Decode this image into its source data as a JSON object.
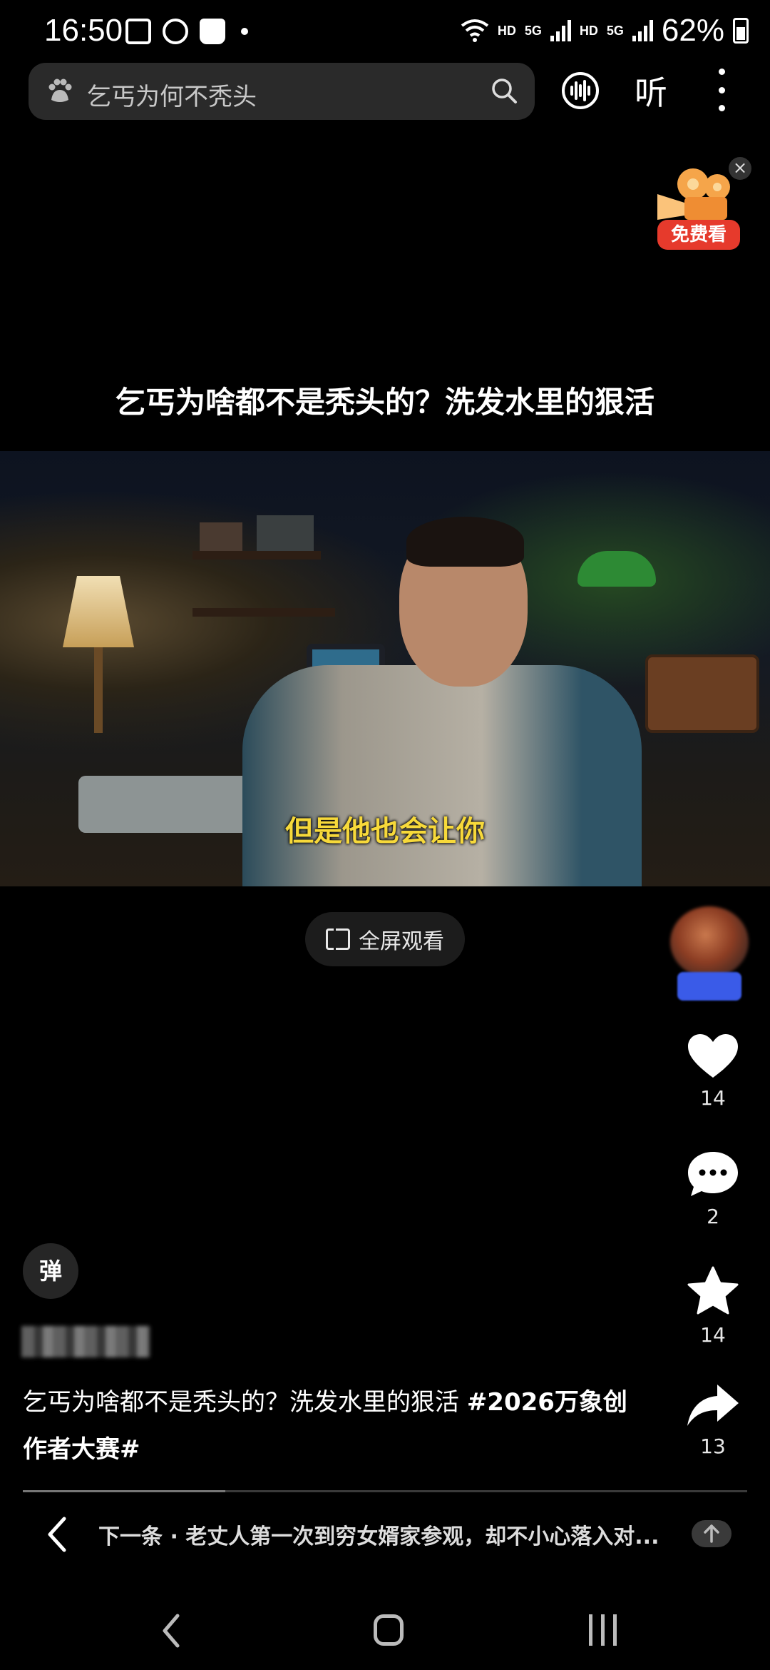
{
  "status_bar": {
    "time": "16:50",
    "hd1": "HD",
    "sig1": "5G",
    "hd2": "HD",
    "sig2": "5G",
    "battery": "62%"
  },
  "search": {
    "query": "乞丐为何不秃头",
    "listen_label": "听"
  },
  "promo": {
    "label": "免费看",
    "close": "×"
  },
  "video": {
    "title": "乞丐为啥都不是秃头的？洗发水里的狠活",
    "subtitle": "但是他也会让你",
    "fullscreen_label": "全屏观看",
    "progress": 0.28
  },
  "rail": {
    "likes": "14",
    "comments": "2",
    "favorites": "14",
    "shares": "13"
  },
  "danmaku_label": "弹",
  "description": {
    "text": "乞丐为啥都不是秃头的？洗发水里的狠活 ",
    "hashtag": "#2026万象创作者大赛#"
  },
  "next": {
    "text": "下一条 · 老丈人第一次到穷女婿家参观，却不小心落入对..."
  },
  "colors": {
    "background": "#000000",
    "subtitle": "#f7d93a",
    "promo": "#e63a2c"
  }
}
